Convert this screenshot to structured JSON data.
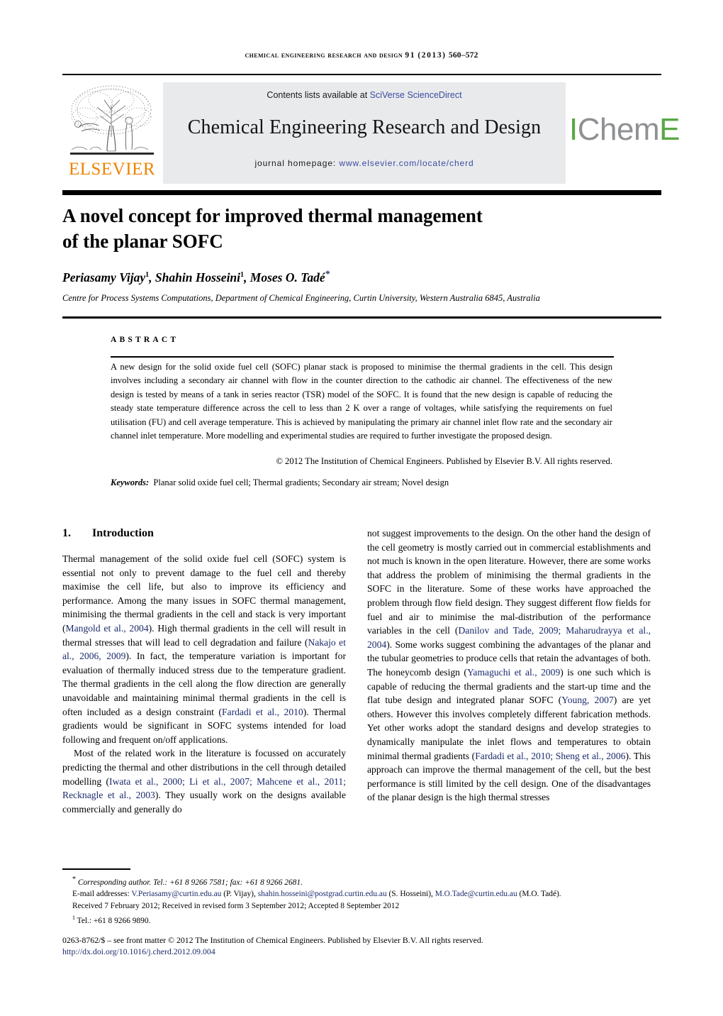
{
  "running_head": {
    "journal": "CHEMICAL ENGINEERING RESEARCH AND DESIGN",
    "volume": "91",
    "year": "(2013)",
    "pages": "560–572"
  },
  "banner": {
    "contents_prefix": "Contents lists available at ",
    "contents_link": "SciVerse ScienceDirect",
    "journal_title": "Chemical Engineering Research and Design",
    "homepage_prefix": "journal homepage: ",
    "homepage_url": "www.elsevier.com/locate/cherd",
    "elsevier_wordmark": "ELSEVIER",
    "icheme": {
      "i": "I",
      "chem": "Chem",
      "e": "E"
    }
  },
  "article": {
    "title_line1": "A novel concept for improved thermal management",
    "title_line2": "of the planar SOFC",
    "authors": [
      {
        "name": "Periasamy Vijay",
        "mark": "1"
      },
      {
        "name": "Shahin Hosseini",
        "mark": "1"
      },
      {
        "name": "Moses O. Tadé",
        "mark": "*"
      }
    ],
    "affiliation": "Centre for Process Systems Computations, Department of Chemical Engineering, Curtin University, Western Australia 6845, Australia"
  },
  "abstract": {
    "label": "ABSTRACT",
    "text": "A new design for the solid oxide fuel cell (SOFC) planar stack is proposed to minimise the thermal gradients in the cell. This design involves including a secondary air channel with flow in the counter direction to the cathodic air channel. The effectiveness of the new design is tested by means of a tank in series reactor (TSR) model of the SOFC. It is found that the new design is capable of reducing the steady state temperature difference across the cell to less than 2 K over a range of voltages, while satisfying the requirements on fuel utilisation (FU) and cell average temperature. This is achieved by manipulating the primary air channel inlet flow rate and the secondary air channel inlet temperature. More modelling and experimental studies are required to further investigate the proposed design.",
    "copyright": "© 2012 The Institution of Chemical Engineers. Published by Elsevier B.V. All rights reserved.",
    "keywords_label": "Keywords:",
    "keywords_value": "Planar solid oxide fuel cell; Thermal gradients; Secondary air stream; Novel design"
  },
  "body": {
    "section_number": "1.",
    "section_title": "Introduction",
    "left_paragraph_1_a": "Thermal management of the solid oxide fuel cell (SOFC) system is essential not only to prevent damage to the fuel cell and thereby maximise the cell life, but also to improve its efficiency and performance. Among the many issues in SOFC thermal management, minimising the thermal gradients in the cell and stack is very important (",
    "left_ref_1": "Mangold et al., 2004",
    "left_paragraph_1_b": "). High thermal gradients in the cell will result in thermal stresses that will lead to cell degradation and failure (",
    "left_ref_2": "Nakajo et al., 2006, 2009",
    "left_paragraph_1_c": "). In fact, the temperature variation is important for evaluation of thermally induced stress due to the temperature gradient. The thermal gradients in the cell along the flow direction are generally unavoidable and maintaining minimal thermal gradients in the cell is often included as a design constraint (",
    "left_ref_3": "Fardadi et al., 2010",
    "left_paragraph_1_d": "). Thermal gradients would be significant in SOFC systems intended for load following and frequent on/off applications.",
    "left_paragraph_2_a": "Most of the related work in the literature is focussed on accurately predicting the thermal and other distributions in the cell through detailed modelling (",
    "left_ref_4": "Iwata et al., 2000; Li et al., 2007; Mahcene et al., 2011; Recknagle et al., 2003",
    "left_paragraph_2_b": "). They usually work on the designs available commercially and generally do",
    "right_paragraph_a": "not suggest improvements to the design. On the other hand the design of the cell geometry is mostly carried out in commercial establishments and not much is known in the open literature. However, there are some works that address the problem of minimising the thermal gradients in the SOFC in the literature. Some of these works have approached the problem through flow field design. They suggest different flow fields for fuel and air to minimise the mal-distribution of the performance variables in the cell (",
    "right_ref_1": "Danilov and Tade, 2009; Maharudrayya et al., 2004",
    "right_paragraph_b": "). Some works suggest combining the advantages of the planar and the tubular geometries to produce cells that retain the advantages of both. The honeycomb design (",
    "right_ref_2": "Yamaguchi et al., 2009",
    "right_paragraph_c": ") is one such which is capable of reducing the thermal gradients and the start-up time and the flat tube design and integrated planar SOFC (",
    "right_ref_3": "Young, 2007",
    "right_paragraph_d": ") are yet others. However this involves completely different fabrication methods. Yet other works adopt the standard designs and develop strategies to dynamically manipulate the inlet flows and temperatures to obtain minimal thermal gradients (",
    "right_ref_4": "Fardadi et al., 2010; Sheng et al., 2006",
    "right_paragraph_e": "). This approach can improve the thermal management of the cell, but the best performance is still limited by the cell design. One of the disadvantages of the planar design is the high thermal stresses"
  },
  "footnotes": {
    "corresponding": "Corresponding author. Tel.: +61 8 9266 7581; fax: +61 8 9266 2681.",
    "email_label": "E-mail addresses:",
    "email_1": "V.Periasamy@curtin.edu.au",
    "email_1_owner": "(P. Vijay),",
    "email_2": "shahin.hosseini@postgrad.curtin.edu.au",
    "email_2_owner": "(S. Hosseini),",
    "email_3": "M.O.Tade@curtin.edu.au",
    "email_3_owner": "(M.O. Tadé).",
    "received": "Received 7 February 2012; Received in revised form 3 September 2012; Accepted 8 September 2012",
    "tel_mark": "1",
    "tel": "Tel.: +61 8 9266 9890."
  },
  "imprint": {
    "line": "0263-8762/$ – see front matter © 2012 The Institution of Chemical Engineers. Published by Elsevier B.V. All rights reserved.",
    "doi": "http://dx.doi.org/10.1016/j.cherd.2012.09.004"
  },
  "colors": {
    "link_blue": "#3b4ba0",
    "ref_blue": "#1b2a6b",
    "elsevier_orange": "#ef8200",
    "icheme_green": "#5aa746",
    "icheme_gray": "#8e9093",
    "banner_bg": "#e9eaec"
  }
}
